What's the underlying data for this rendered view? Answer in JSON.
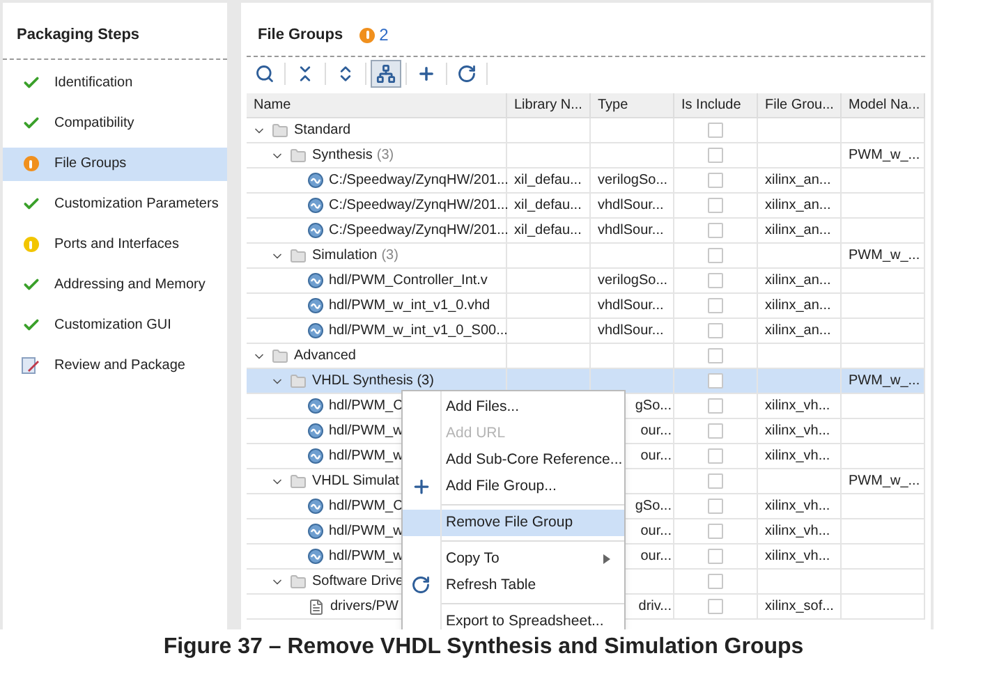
{
  "sidebar": {
    "title": "Packaging Steps",
    "items": [
      {
        "label": "Identification",
        "kind": "complete",
        "selected": false
      },
      {
        "label": "Compatibility",
        "kind": "complete",
        "selected": false
      },
      {
        "label": "File Groups",
        "kind": "error",
        "selected": true
      },
      {
        "label": "Customization Parameters",
        "kind": "complete",
        "selected": false
      },
      {
        "label": "Ports and Interfaces",
        "kind": "warning",
        "selected": false
      },
      {
        "label": "Addressing and Memory",
        "kind": "complete",
        "selected": false
      },
      {
        "label": "Customization GUI",
        "kind": "complete",
        "selected": false
      },
      {
        "label": "Review and Package",
        "kind": "review",
        "selected": false
      }
    ]
  },
  "panel": {
    "title": "File Groups",
    "issue_count": "2"
  },
  "toolbar": [
    {
      "kind": "search",
      "selected": false
    },
    {
      "kind": "collapse_all",
      "selected": false
    },
    {
      "kind": "expand_all",
      "selected": false
    },
    {
      "kind": "hierarchy",
      "selected": true
    },
    {
      "kind": "add",
      "selected": false
    },
    {
      "kind": "refresh",
      "selected": false
    }
  ],
  "columns": [
    "Name",
    "Library N...",
    "Type",
    "Is Include",
    "File Grou...",
    "Model Na..."
  ],
  "tree": [
    {
      "kind": "group",
      "name": "Standard",
      "expanded": true,
      "selected": false,
      "include": false,
      "children": [
        {
          "kind": "group",
          "name": "Synthesis",
          "count": "(3)",
          "expanded": true,
          "selected": false,
          "include": false,
          "model": "PWM_w_...",
          "children": [
            {
              "kind": "source",
              "name": "C:/Speedway/ZynqHW/201...",
              "library": "xil_defau...",
              "type": "verilogSo...",
              "include": false,
              "file_group": "xilinx_an...",
              "selected": false
            },
            {
              "kind": "source",
              "name": "C:/Speedway/ZynqHW/201...",
              "library": "xil_defau...",
              "type": "vhdlSour...",
              "include": false,
              "file_group": "xilinx_an...",
              "selected": false
            },
            {
              "kind": "source",
              "name": "C:/Speedway/ZynqHW/201...",
              "library": "xil_defau...",
              "type": "vhdlSour...",
              "include": false,
              "file_group": "xilinx_an...",
              "selected": false
            }
          ]
        },
        {
          "kind": "group",
          "name": "Simulation",
          "count": "(3)",
          "expanded": true,
          "selected": false,
          "include": false,
          "model": "PWM_w_...",
          "children": [
            {
              "kind": "source",
              "name": "hdl/PWM_Controller_Int.v",
              "type": "verilogSo...",
              "include": false,
              "file_group": "xilinx_an...",
              "selected": false
            },
            {
              "kind": "source",
              "name": "hdl/PWM_w_int_v1_0.vhd",
              "type": "vhdlSour...",
              "include": false,
              "file_group": "xilinx_an...",
              "selected": false
            },
            {
              "kind": "source",
              "name": "hdl/PWM_w_int_v1_0_S00...",
              "type": "vhdlSour...",
              "include": false,
              "file_group": "xilinx_an...",
              "selected": false
            }
          ]
        }
      ]
    },
    {
      "kind": "group",
      "name": "Advanced",
      "expanded": true,
      "selected": false,
      "include": false,
      "children": [
        {
          "kind": "group",
          "name": "VHDL Synthesis (3)",
          "expanded": true,
          "selected": true,
          "include": false,
          "model": "PWM_w_...",
          "children": [
            {
              "kind": "source",
              "name": "hdl/PWM_C",
              "type": "gSo...",
              "include": false,
              "file_group": "xilinx_vh...",
              "selected": false
            },
            {
              "kind": "source",
              "name": "hdl/PWM_w",
              "type": "our...",
              "include": false,
              "file_group": "xilinx_vh...",
              "selected": false
            },
            {
              "kind": "source",
              "name": "hdl/PWM_w",
              "type": "our...",
              "include": false,
              "file_group": "xilinx_vh...",
              "selected": false
            }
          ]
        },
        {
          "kind": "group",
          "name": "VHDL Simulat",
          "expanded": true,
          "selected": false,
          "include": false,
          "model": "PWM_w_...",
          "children": [
            {
              "kind": "source",
              "name": "hdl/PWM_C",
              "type": "gSo...",
              "include": false,
              "file_group": "xilinx_vh...",
              "selected": false
            },
            {
              "kind": "source",
              "name": "hdl/PWM_w",
              "type": "our...",
              "include": false,
              "file_group": "xilinx_vh...",
              "selected": false
            },
            {
              "kind": "source",
              "name": "hdl/PWM_w",
              "type": "our...",
              "include": false,
              "file_group": "xilinx_vh...",
              "selected": false
            }
          ]
        },
        {
          "kind": "group",
          "name": "Software Drive",
          "expanded": true,
          "selected": false,
          "include": false,
          "children": [
            {
              "kind": "document",
              "name": "drivers/PW",
              "type": "driv...",
              "include": false,
              "file_group": "xilinx_sof...",
              "selected": false
            }
          ]
        }
      ]
    }
  ],
  "context_menu": [
    {
      "label": "Add Files...",
      "kind": "plain",
      "disabled": false,
      "selected": false
    },
    {
      "label": "Add URL",
      "kind": "plain",
      "disabled": true,
      "selected": false
    },
    {
      "label": "Add Sub-Core Reference...",
      "kind": "plain",
      "disabled": false,
      "selected": false
    },
    {
      "label": "Add File Group...",
      "kind": "add",
      "disabled": false,
      "selected": false
    },
    {
      "kind": "separator"
    },
    {
      "label": "Remove File Group",
      "kind": "plain",
      "disabled": false,
      "selected": true
    },
    {
      "kind": "separator"
    },
    {
      "label": "Copy To",
      "kind": "submenu",
      "disabled": false,
      "selected": false
    },
    {
      "label": "Refresh Table",
      "kind": "refresh",
      "disabled": false,
      "selected": false
    },
    {
      "kind": "separator"
    },
    {
      "label": "Export to Spreadsheet...",
      "kind": "plain",
      "disabled": false,
      "selected": false
    }
  ],
  "caption": "Figure 37 – Remove VHDL Synthesis and Simulation Groups"
}
